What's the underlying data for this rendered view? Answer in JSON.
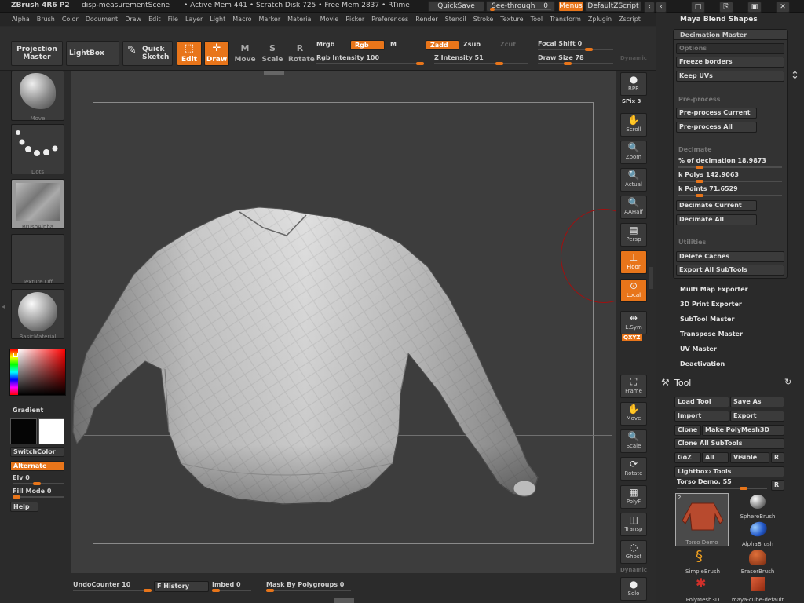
{
  "titlebar": {
    "app": "ZBrush 4R6 P2",
    "scene": "disp-measurementScene",
    "mem": "• Active Mem 441  • Scratch Disk 725  • Free Mem 2837  • RTime",
    "quicksave": "QuickSave",
    "seethrough": "See-through",
    "seethrough_value": "0",
    "menus": "Menus",
    "script": "DefaultZScript",
    "window_controls": [
      "‹",
      "‹",
      "□",
      "⎘",
      "▣",
      "✕"
    ]
  },
  "menubar": [
    "Alpha",
    "Brush",
    "Color",
    "Document",
    "Draw",
    "Edit",
    "File",
    "Layer",
    "Light",
    "Macro",
    "Marker",
    "Material",
    "Movie",
    "Picker",
    "Preferences",
    "Render",
    "Stencil",
    "Stroke",
    "Texture",
    "Tool",
    "Transform",
    "Zplugin",
    "Zscript"
  ],
  "toolbar": {
    "projection_master": "Projection Master",
    "lightbox": "LightBox",
    "quick_sketch": "Quick Sketch",
    "edit": "Edit",
    "draw": "Draw",
    "move": "Move",
    "scale": "Scale",
    "rotate": "Rotate",
    "mrgb": "Mrgb",
    "rgb": "Rgb",
    "m": "M",
    "rgb_intensity": "Rgb  Intensity 100",
    "zadd": "Zadd",
    "zsub": "Zsub",
    "zcut": "Zcut",
    "z_intensity": "Z Intensity 51",
    "focal_shift": "Focal Shift 0",
    "draw_size": "Draw Size 78",
    "dynamic": "Dynamic"
  },
  "leftshelf": {
    "brush_label": "Move",
    "stroke_label": "Dots",
    "alpha_label": "BrushAlpha",
    "texture_label": "Texture Off",
    "material_label": "BasicMaterial",
    "gradient": "Gradient",
    "switchcolor": "SwitchColor",
    "alternate": "Alternate",
    "elv": "Elv 0",
    "fill_mode": "Fill Mode 0",
    "help": "Help"
  },
  "rightshelf": [
    {
      "name": "bpr",
      "label": "BPR",
      "icon": "●"
    },
    {
      "name": "spix",
      "label": "SPix 3",
      "icon": ""
    },
    {
      "name": "scroll",
      "label": "Scroll",
      "icon": "✋"
    },
    {
      "name": "zoom",
      "label": "Zoom",
      "icon": "🔍"
    },
    {
      "name": "actual",
      "label": "Actual",
      "icon": "🔍"
    },
    {
      "name": "aahalf",
      "label": "AAHalf",
      "icon": "🔍"
    },
    {
      "name": "persp",
      "label": "Persp",
      "icon": "▤"
    },
    {
      "name": "floor",
      "label": "Floor",
      "icon": "⊥"
    },
    {
      "name": "local",
      "label": "Local",
      "icon": "⊙"
    },
    {
      "name": "lsym",
      "label": "L.Sym",
      "icon": "⇹"
    },
    {
      "name": "xyz",
      "label": "QXYZ",
      "icon": ""
    },
    {
      "name": "frame",
      "label": "Frame",
      "icon": "⛶"
    },
    {
      "name": "move",
      "label": "Move",
      "icon": "✋"
    },
    {
      "name": "scale",
      "label": "Scale",
      "icon": "🔍"
    },
    {
      "name": "rotate",
      "label": "Rotate",
      "icon": "⟳"
    },
    {
      "name": "polyf",
      "label": "PolyF",
      "icon": "▦"
    },
    {
      "name": "transp",
      "label": "Transp",
      "icon": "◫"
    },
    {
      "name": "ghost",
      "label": "Ghost",
      "icon": "◌"
    },
    {
      "name": "dynamic",
      "label": "Dynamic",
      "icon": ""
    },
    {
      "name": "solo",
      "label": "Solo",
      "icon": "●"
    }
  ],
  "rpanel": {
    "maya_blend": "Maya Blend Shapes",
    "decimation_master": "Decimation Master",
    "options": "Options",
    "freeze_borders": "Freeze borders",
    "keep_uvs": "Keep UVs",
    "preprocess_label": "Pre-process",
    "preprocess_current": "Pre-process Current",
    "preprocess_all": "Pre-process All",
    "decimate_label": "Decimate",
    "pct_decimation": "% of decimation 18.9873",
    "k_polys": "k Polys 142.9063",
    "k_points": "k Points 71.6529",
    "decimate_current": "Decimate Current",
    "decimate_all": "Decimate All",
    "utilities": "Utilities",
    "delete_caches": "Delete Caches",
    "export_all_subtools": "Export All SubTools",
    "plugins": [
      "Multi Map Exporter",
      "3D Print Exporter",
      "SubTool Master",
      "Transpose Master",
      "UV Master",
      "Deactivation"
    ],
    "tool_title": "Tool",
    "load_tool": "Load Tool",
    "save_as": "Save As",
    "import": "Import",
    "export": "Export",
    "clone": "Clone",
    "make_polymesh": "Make PolyMesh3D",
    "clone_all": "Clone All SubTools",
    "goz": "GoZ",
    "all": "All",
    "visible": "Visible",
    "r": "R",
    "lightbox_tools": "Lightbox› Tools",
    "current_tool": "Torso Demo. 55",
    "tools": [
      {
        "name": "torso-demo",
        "label": "Torso Demo"
      },
      {
        "name": "spherebrush",
        "label": "SphereBrush"
      },
      {
        "name": "alphabrush",
        "label": "AlphaBrush"
      },
      {
        "name": "simplebrush",
        "label": "SimpleBrush"
      },
      {
        "name": "eraserbrush",
        "label": "EraserBrush"
      },
      {
        "name": "polymesh3d",
        "label": "PolyMesh3D"
      },
      {
        "name": "maya-cube",
        "label": "maya-cube-default"
      }
    ],
    "tool_count": "2"
  },
  "bottombar": {
    "undo_counter": "UndoCounter 10",
    "f_history": "F History",
    "imbed": "Imbed 0",
    "mask_polygroups": "Mask By Polygroups 0"
  },
  "colors": {
    "accent": "#e8751a",
    "bg": "#2b2b2b",
    "canvas": "#3d3d3d"
  }
}
